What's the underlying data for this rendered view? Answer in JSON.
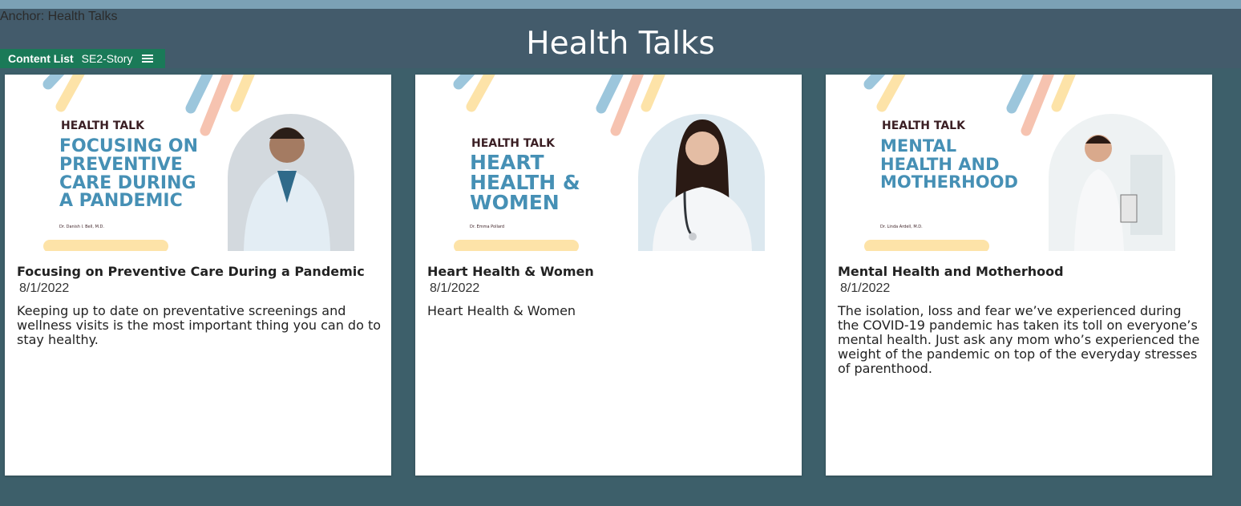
{
  "header": {
    "anchor_text": "Anchor: Health Talks",
    "title": "Health Talks"
  },
  "content_tag": {
    "label": "Content List",
    "story": "SE2-Story",
    "menu_icon": "hamburger-menu-icon"
  },
  "colors": {
    "background": "#3d5f6a",
    "header": "#435b6b",
    "tag": "#1a7a58",
    "accent_blue": "#4690b5"
  },
  "cards": [
    {
      "image": {
        "kicker": "HEALTH TALK",
        "headline_lines": [
          "FOCUSING ON",
          "PREVENTIVE",
          "CARE DURING",
          "A PANDEMIC"
        ],
        "byline": "Dr. Danish I. Bell, M.D."
      },
      "title": "Focusing on Preventive Care During a Pandemic",
      "date": "8/1/2022",
      "description": "Keeping up to date on preventative screenings and wellness visits is the most important thing you can do to stay healthy."
    },
    {
      "image": {
        "kicker": "HEALTH TALK",
        "headline_lines": [
          "HEART",
          "HEALTH &",
          "WOMEN"
        ],
        "byline": "Dr. Emma Pollard"
      },
      "title": "Heart Health & Women",
      "date": "8/1/2022",
      "description": "Heart Health & Women"
    },
    {
      "image": {
        "kicker": "HEALTH TALK",
        "headline_lines": [
          "MENTAL",
          "HEALTH AND",
          "MOTHERHOOD"
        ],
        "byline": "Dr. Linda Ardell, M.D."
      },
      "title": "Mental Health and Motherhood",
      "date": "8/1/2022",
      "description": "The isolation, loss and fear we’ve experienced during the COVID-19 pandemic has taken its toll on everyone’s mental health. Just ask any mom who’s experienced the weight of the pandemic on top of the everyday stresses of parenthood."
    }
  ]
}
